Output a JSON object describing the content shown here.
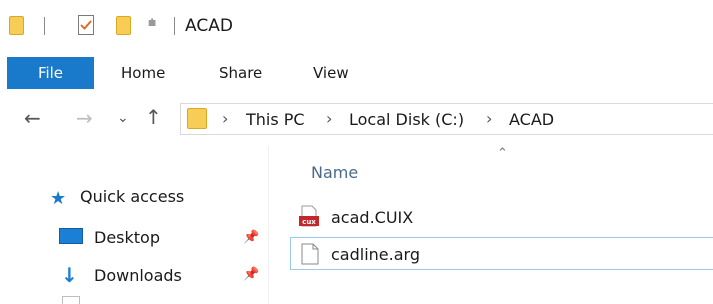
{
  "window": {
    "title": "ACAD"
  },
  "ribbon": {
    "tabs": [
      "File",
      "Home",
      "Share",
      "View"
    ]
  },
  "address": {
    "crumbs": [
      "This PC",
      "Local Disk (C:)",
      "ACAD"
    ]
  },
  "nav": {
    "quick_access": "Quick access",
    "items": [
      {
        "label": "Desktop",
        "pinned": true
      },
      {
        "label": "Downloads",
        "pinned": true
      }
    ]
  },
  "list": {
    "column_header": "Name",
    "files": [
      {
        "name": "acad.CUIX",
        "icon": "cuix-file-icon"
      },
      {
        "name": "cadline.arg",
        "icon": "generic-file-icon"
      }
    ]
  },
  "colors": {
    "accent": "#1979ca",
    "folder": "#f7cd55",
    "selection_border": "#99c9ef"
  }
}
